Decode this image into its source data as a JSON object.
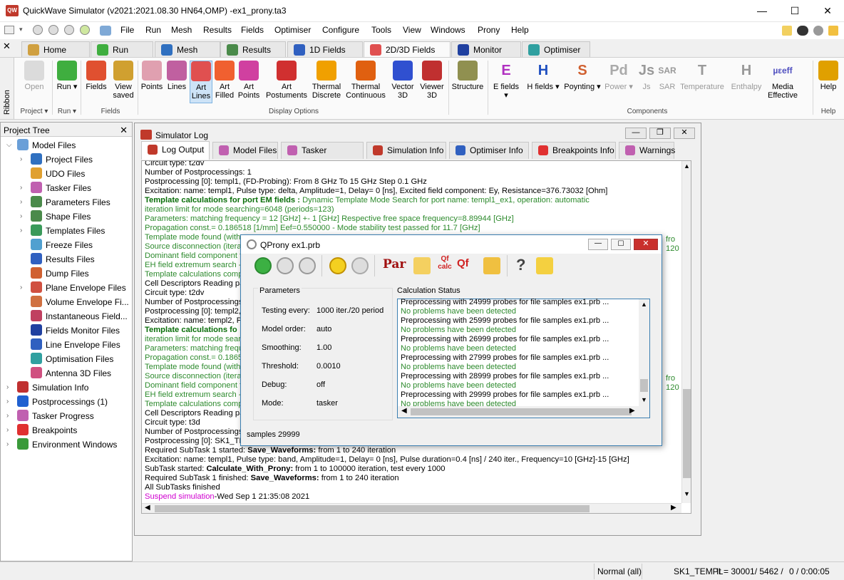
{
  "window": {
    "title": "QuickWave Simulator (v2021:2021.08.30 HN64,OMP) -ex1_prony.ta3",
    "app_icon": "QW",
    "min": "—",
    "max": "☐",
    "close": "✕"
  },
  "menu": [
    "File",
    "Run",
    "Mesh",
    "Results",
    "Fields",
    "Optimiser",
    "Configure",
    "Tools",
    "View",
    "Windows",
    "Prony",
    "Help"
  ],
  "tabs": [
    "Home",
    "Run",
    "Mesh",
    "Results",
    "1D Fields",
    "2D/3D Fields",
    "Monitor",
    "Optimiser"
  ],
  "ribbon": {
    "side_label": "Ribbon",
    "buttons": [
      {
        "l": "Open",
        "c": "#bbbbbb",
        "dis": true
      },
      {
        "l": "Run ▾",
        "c": "#3fae3f"
      },
      {
        "l": "Fields",
        "c": "#e05030"
      },
      {
        "l": "View saved",
        "c": "#d0a030"
      },
      {
        "l": "Points",
        "c": "#e0a0b0"
      },
      {
        "l": "Lines",
        "c": "#c060a0"
      },
      {
        "l": "Art Lines",
        "c": "#e05050"
      },
      {
        "l": "Art Filled",
        "c": "#f06030"
      },
      {
        "l": "Art Points",
        "c": "#d040a0"
      },
      {
        "l": "Art Postuments",
        "c": "#d03030"
      },
      {
        "l": "Thermal Discrete",
        "c": "#f0a000"
      },
      {
        "l": "Thermal Continuous",
        "c": "#e06010"
      },
      {
        "l": "Vector 3D",
        "c": "#3050d0"
      },
      {
        "l": "Viewer 3D",
        "c": "#c03030"
      },
      {
        "l": "Structure",
        "c": "#909050"
      },
      {
        "l": "E fields ▾",
        "c": "#b030c0",
        "t": "E"
      },
      {
        "l": "H fields ▾",
        "c": "#2050c0",
        "t": "H"
      },
      {
        "l": "Poynting ▾",
        "c": "#d06030",
        "t": "S"
      },
      {
        "l": "Power ▾",
        "c": "#aaaaaa",
        "t": "Pd",
        "dis": true
      },
      {
        "l": "Js",
        "c": "#999999",
        "t": "Js",
        "dis": true
      },
      {
        "l": "SAR",
        "c": "#999999",
        "t": "SAR",
        "dis": true
      },
      {
        "l": "Temperature",
        "c": "#999999",
        "t": "T",
        "dis": true
      },
      {
        "l": "Enthalpy",
        "c": "#999999",
        "t": "H",
        "dis": true
      },
      {
        "l": "Media Effective",
        "c": "#5050c0",
        "t": "µεeff"
      },
      {
        "l": "Help",
        "c": "#e0a000"
      }
    ],
    "groups": [
      "Project ▾",
      "Run ▾",
      "Fields",
      "Display Options",
      "Components",
      "Help"
    ]
  },
  "project_tree": {
    "title": "Project Tree",
    "items": [
      {
        "l": "Model Files",
        "c": "#6a9fd8"
      },
      {
        "l": "Project Files",
        "c": "#3070c0"
      },
      {
        "l": "UDO Files",
        "c": "#e0a030"
      },
      {
        "l": "Tasker Files",
        "c": "#c060b0"
      },
      {
        "l": "Parameters Files",
        "c": "#4a8a4a"
      },
      {
        "l": "Shape Files",
        "c": "#4a8a4a"
      },
      {
        "l": "Templates Files",
        "c": "#3a9a5a"
      },
      {
        "l": "Freeze Files",
        "c": "#50a0d0"
      },
      {
        "l": "Results Files",
        "c": "#3060c0"
      },
      {
        "l": "Dump Files",
        "c": "#d06030"
      },
      {
        "l": "Plane Envelope Files",
        "c": "#d05040"
      },
      {
        "l": "Volume Envelope Fi...",
        "c": "#d07040"
      },
      {
        "l": "Instantaneous Field...",
        "c": "#c04060"
      },
      {
        "l": "Fields Monitor Files",
        "c": "#2040a0"
      },
      {
        "l": "Line Envelope Files",
        "c": "#3060c0"
      },
      {
        "l": "Optimisation Files",
        "c": "#30a0a0"
      },
      {
        "l": "Antenna 3D Files",
        "c": "#d05080"
      },
      {
        "l": "Simulation Info",
        "c": "#c03030"
      },
      {
        "l": "Postprocessings (1)",
        "c": "#2060d0"
      },
      {
        "l": "Tasker Progress",
        "c": "#c060b0"
      },
      {
        "l": "Breakpoints",
        "c": "#e03030"
      },
      {
        "l": "Environment Windows",
        "c": "#3a9a3a"
      }
    ]
  },
  "simlog": {
    "title": "Simulator Log",
    "tabs": [
      "Log Output",
      "Model Files",
      "Tasker Progress",
      "Simulation Info",
      "Optimiser Info",
      "Breakpoints Info",
      "Warnings"
    ],
    "lines": [
      {
        "t": "Circuit type: t2dv",
        "s": ""
      },
      {
        "t": "Number of Postprocessings: 1",
        "s": ""
      },
      {
        "t": "Postprocessing [0]: templ1, (FD-Probing): From 8 GHz To 15 GHz Step 0.1 GHz",
        "s": ""
      },
      {
        "t": "Excitation: name: templ1, Pulse type: delta, Amplitude=1, Delay= 0 [ns], Excited field component: Ey, Resistance=376.73032 [Ohm]",
        "s": ""
      },
      {
        "b": "Template calculations for port EM fields :",
        "t": " Dynamic Template Mode Search for port name: templ1_ex1, operation: automatic",
        "s": "g"
      },
      {
        "t": "iteration limit for mode searching=6048 (periods=123)",
        "s": "g"
      },
      {
        "t": "Parameters: matching frequency = 12 [GHz] +- 1 [GHz] Respective free space frequency=8.89944 [GHz]",
        "s": "g"
      },
      {
        "t": "Propagation const.= 0.186518 [1/mm] Eef=0.550000 - Mode stability test passed for 11.7 [GHz]",
        "s": "g"
      },
      {
        "t": "Template mode found (with",
        "s": "g"
      },
      {
        "t": "Source disconnection (iterat",
        "s": "g"
      },
      {
        "t": "Dominant field component fo",
        "s": "g"
      },
      {
        "t": "EH field extremum search -E",
        "s": "g"
      },
      {
        "t": "Template calculations comple",
        "s": "g"
      },
      {
        "t": "Cell Descriptors Reading pas",
        "s": ""
      },
      {
        "t": "Circuit type: t2dv",
        "s": ""
      },
      {
        "t": "Number of Postprocessings:",
        "s": ""
      },
      {
        "t": "Postprocessing [0]: templ2,",
        "s": ""
      },
      {
        "t": "Excitation: name: templ2, Pu",
        "s": ""
      },
      {
        "b": "Template calculations fo",
        "t": "",
        "s": "g"
      },
      {
        "t": "iteration limit for mode searc",
        "s": "g"
      },
      {
        "t": "Parameters: matching frequ",
        "s": "g"
      },
      {
        "t": "Propagation const.= 0.1865",
        "s": "g"
      },
      {
        "t": "Template mode found (with",
        "s": "g"
      },
      {
        "t": "Source disconnection (iterat",
        "s": "g"
      },
      {
        "t": "Dominant field component fo",
        "s": "g"
      },
      {
        "t": "EH field extremum search -E",
        "s": "g"
      },
      {
        "t": "Template calculations comple",
        "s": "g"
      },
      {
        "t": "Cell Descriptors Reading pas",
        "s": ""
      },
      {
        "t": "Circuit type: t3d",
        "s": ""
      },
      {
        "t": "Number of Postprocessings:",
        "s": ""
      },
      {
        "t": "Postprocessing [0]: SK1_TE",
        "s": ""
      },
      {
        "t": "Required SubTask 1 started: ",
        "b2": "Save_Waveforms:",
        "t2": " from 1 to 240 iteration",
        "s": ""
      },
      {
        "t": "Excitation: name: templ1, Pulse type: band, Amplitude=1, Delay= 0 [ns], Pulse duration=0.4 [ns] / 240 iter., Frequency=10 [GHz]-15 [GHz]",
        "s": ""
      },
      {
        "t": "SubTask started: ",
        "b2": "Calculate_With_Prony:",
        "t2": " from 1 to 100000 iteration, test every 1000",
        "s": ""
      },
      {
        "t": "Required SubTask 1 finished: ",
        "b2": "Save_Waveforms:",
        "t2": " from 1 to 240 iteration",
        "s": ""
      },
      {
        "t": "All SubTasks finished",
        "s": ""
      },
      {
        "m": "Suspend simulation",
        "t": "-Wed Sep 1 21:35:08 2021",
        "s": ""
      }
    ],
    "right_fragments": [
      "fro",
      "120",
      "fro",
      "120"
    ]
  },
  "qprony": {
    "title": "QProny ex1.prb",
    "params_label": "Parameters",
    "params": [
      {
        "k": "Testing every:",
        "v": "1000 iter./20 period"
      },
      {
        "k": "Model order:",
        "v": "auto"
      },
      {
        "k": "Smoothing:",
        "v": "1.00"
      },
      {
        "k": "Threshold:",
        "v": "0.0010"
      },
      {
        "k": "Debug:",
        "v": "off"
      },
      {
        "k": "Mode:",
        "v": "tasker"
      }
    ],
    "status_label": "Calculation Status",
    "status_lines": [
      {
        "t": "Preprocessing with 24999 probes for file samples ex1.prb ...",
        "g": false
      },
      {
        "t": "No problems have been detected",
        "g": true
      },
      {
        "t": "Preprocessing with 25999 probes for file samples ex1.prb ...",
        "g": false
      },
      {
        "t": "No problems have been detected",
        "g": true
      },
      {
        "t": "Preprocessing with 26999 probes for file samples ex1.prb ...",
        "g": false
      },
      {
        "t": "No problems have been detected",
        "g": true
      },
      {
        "t": "Preprocessing with 27999 probes for file samples ex1.prb ...",
        "g": false
      },
      {
        "t": "No problems have been detected",
        "g": true
      },
      {
        "t": "Preprocessing with 28999 probes for file samples ex1.prb ...",
        "g": false
      },
      {
        "t": "No problems have been detected",
        "g": true
      },
      {
        "t": "Preprocessing with 29999 probes for file samples ex1.prb ...",
        "g": false
      },
      {
        "t": "No problems have been detected",
        "g": true
      }
    ],
    "footer": "samples 29999",
    "toolbar": [
      "Par",
      "Qf calc",
      "Qf",
      "?"
    ]
  },
  "statusbar": {
    "mode": "Normal (all)",
    "task": "SK1_TEMPL",
    "it": "It = 30001/ 5462 /",
    "time": "0 / 0:00:05"
  }
}
